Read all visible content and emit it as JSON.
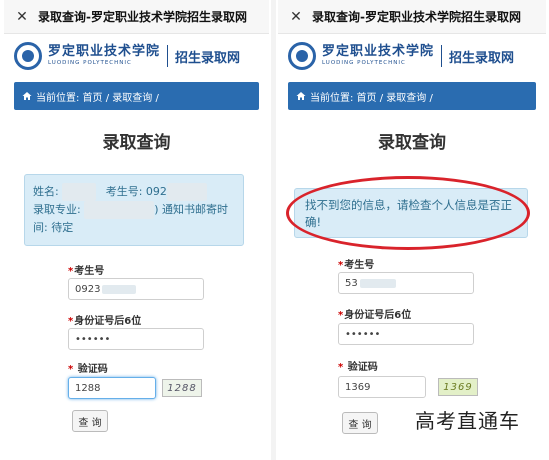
{
  "left": {
    "window_title": "录取查询-罗定职业技术学院招生录取网",
    "logo_cn": "罗定职业技术学院",
    "logo_en": "LUODING POLYTECHNIC",
    "logo_sub": "招生录取网",
    "breadcrumb": "当前位置: 首页 / 录取查询 /",
    "page_title": "录取查询",
    "result": {
      "name_label": "姓名: ",
      "exam_no_label": "考生号: 092",
      "major_label": "录取专业: ",
      "notice_suffix": ") 通知书邮寄时间: 待定"
    },
    "form": {
      "exam_no_label": "考生号",
      "exam_no_value": "0923",
      "id_label": "身份证号后6位",
      "id_value": "••••••",
      "captcha_label": "验证码",
      "captcha_value": "1288",
      "captcha_image": "1288",
      "query_button": "查 询"
    }
  },
  "right": {
    "window_title": "录取查询-罗定职业技术学院招生录取网",
    "logo_cn": "罗定职业技术学院",
    "logo_en": "LUODING POLYTECHNIC",
    "logo_sub": "招生录取网",
    "breadcrumb": "当前位置: 首页 / 录取查询 /",
    "page_title": "录取查询",
    "error_message": "找不到您的信息，请检查个人信息是否正确!",
    "form": {
      "exam_no_label": "考生号",
      "exam_no_value": "53",
      "id_label": "身份证号后6位",
      "id_value": "••••••",
      "captcha_label": "验证码",
      "captcha_value": "1369",
      "captcha_image": "1369",
      "query_button": "查 询"
    }
  },
  "watermark": "高考直通车",
  "colors": {
    "accent_blue": "#2a6cb0",
    "info_bg": "#d9ecf7",
    "highlight_red": "#d9232b"
  }
}
